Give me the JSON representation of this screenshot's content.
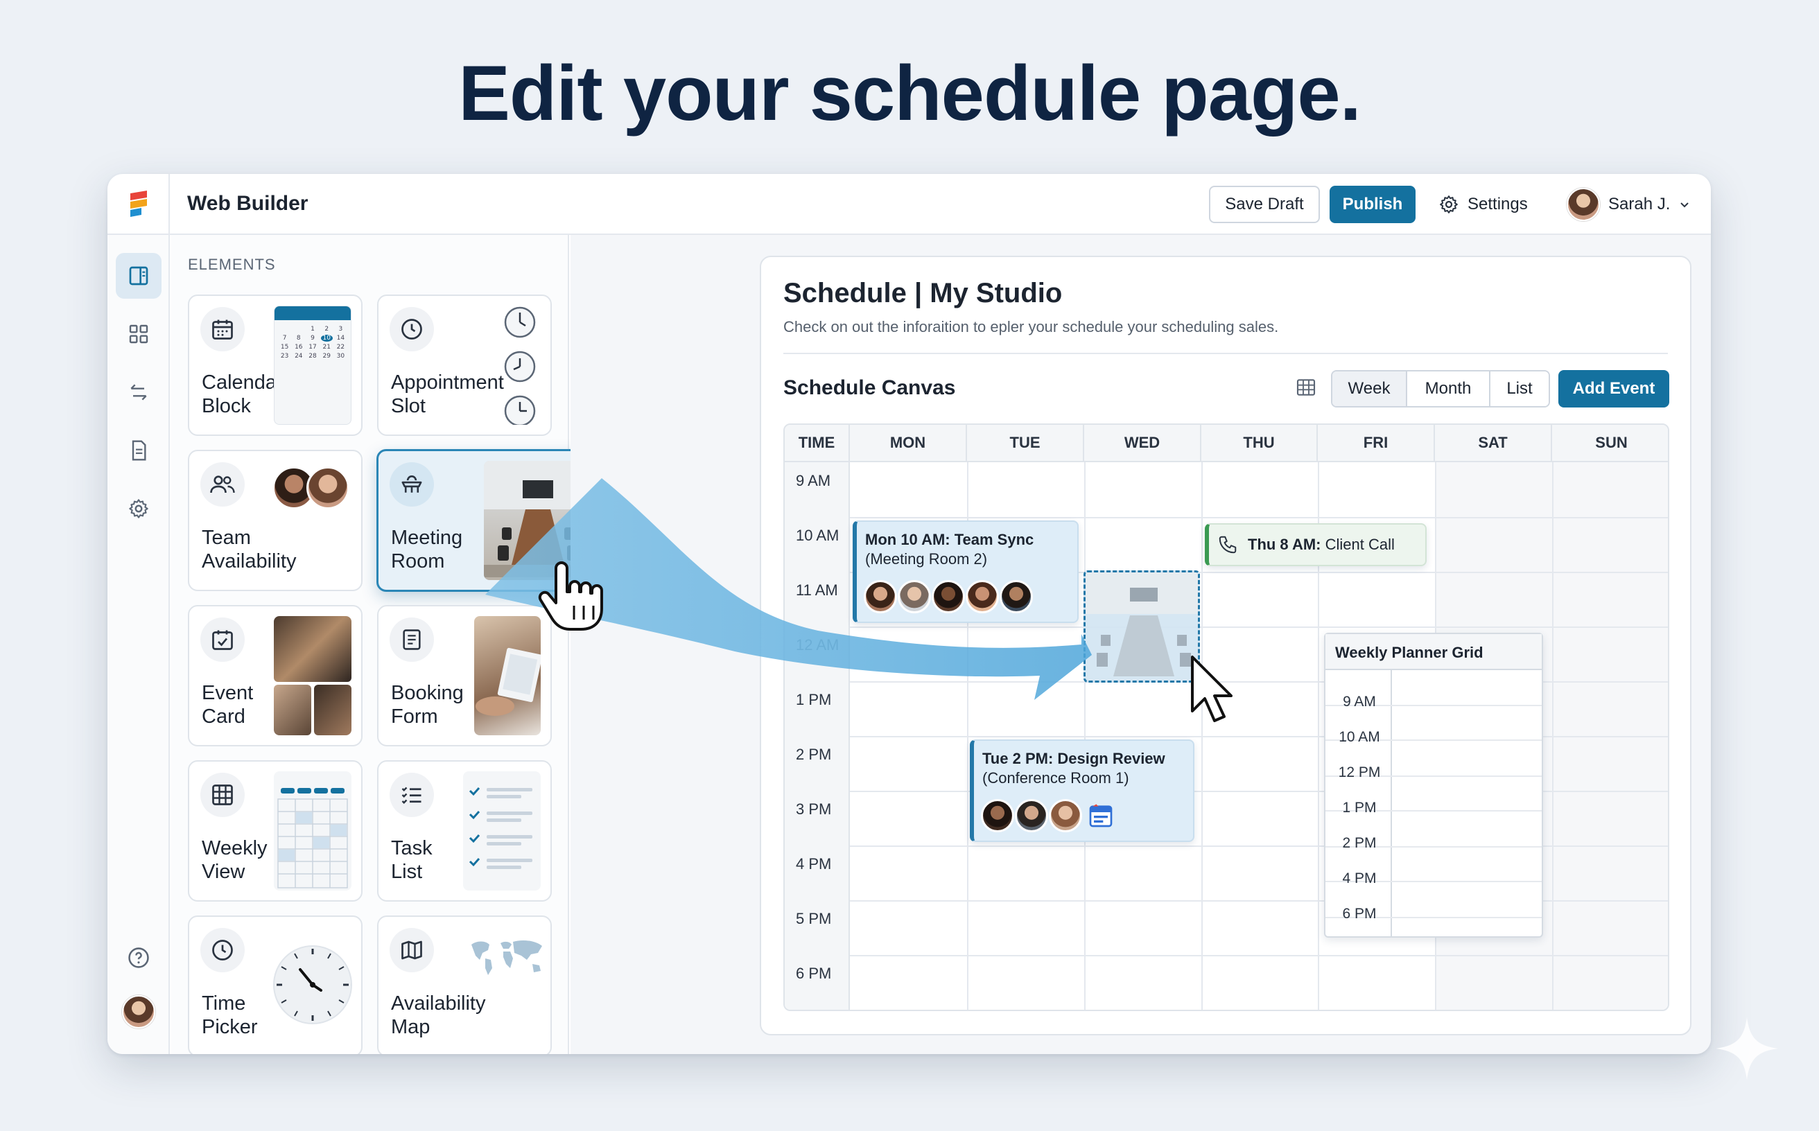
{
  "hero": {
    "title": "Edit your schedule page."
  },
  "app": {
    "title": "Web Builder",
    "save_draft": "Save Draft",
    "publish": "Publish",
    "settings": "Settings",
    "user_name": "Sarah J."
  },
  "rail": {
    "items": [
      "layout-icon",
      "apps-grid-icon",
      "swap-icon",
      "document-icon",
      "gear-icon",
      "help-icon",
      "avatar"
    ]
  },
  "elements": {
    "label": "ELEMENTS",
    "cards": [
      {
        "label": "Calendar\nBlock",
        "icon": "calendar-icon"
      },
      {
        "label": "Appointment\nSlot",
        "icon": "clock-icon"
      },
      {
        "label": "Team\nAvailability",
        "icon": "people-icon"
      },
      {
        "label": "Meeting\nRoom",
        "icon": "meeting-table-icon"
      },
      {
        "label": "Event\nCard",
        "icon": "calendar-check-icon"
      },
      {
        "label": "Booking\nForm",
        "icon": "form-icon"
      },
      {
        "label": "Weekly\nView",
        "icon": "table-grid-icon"
      },
      {
        "label": "Task\nList",
        "icon": "checklist-icon"
      },
      {
        "label": "Time\nPicker",
        "icon": "clock-icon"
      },
      {
        "label": "Availability\nMap",
        "icon": "map-icon"
      }
    ],
    "calendar_thumb_numbers": [
      "1",
      "2",
      "3",
      "7",
      "8",
      "9",
      "10",
      "14",
      "15",
      "16",
      "17",
      "21",
      "22",
      "23",
      "24",
      "28",
      "29",
      "30"
    ]
  },
  "schedule": {
    "title": "Schedule | My Studio",
    "subtitle": "Check on out the inforaition to epler your schedule your scheduling sales.",
    "canvas_title": "Schedule Canvas",
    "views": [
      "Week",
      "Month",
      "List"
    ],
    "active_view": "Week",
    "add_event": "Add Event",
    "columns": [
      "TIME",
      "MON",
      "TUE",
      "WED",
      "THU",
      "FRI",
      "SAT",
      "SUN"
    ],
    "times": [
      "9 AM",
      "10 AM",
      "11 AM",
      "12 AM",
      "1 PM",
      "2 PM",
      "3 PM",
      "4 PM",
      "5 PM",
      "6 PM"
    ],
    "events": [
      {
        "bold": "Mon 10 AM: Team Sync",
        "detail": "(Meeting Room 2)"
      },
      {
        "bold": "Thu 8 AM:",
        "detail": " Client Call"
      },
      {
        "bold": "Tue 2 PM: Design Review",
        "detail": "(Conference Room 1)"
      }
    ],
    "planner": {
      "title": "Weekly Planner Grid",
      "times": [
        "9 AM",
        "10 AM",
        "12 PM",
        "1 PM",
        "2 PM",
        "4 PM",
        "6 PM"
      ]
    }
  },
  "colors": {
    "accent": "#14719f",
    "hero": "#0f2442",
    "event_blue": "#2378a8",
    "event_green": "#3a9a52"
  }
}
